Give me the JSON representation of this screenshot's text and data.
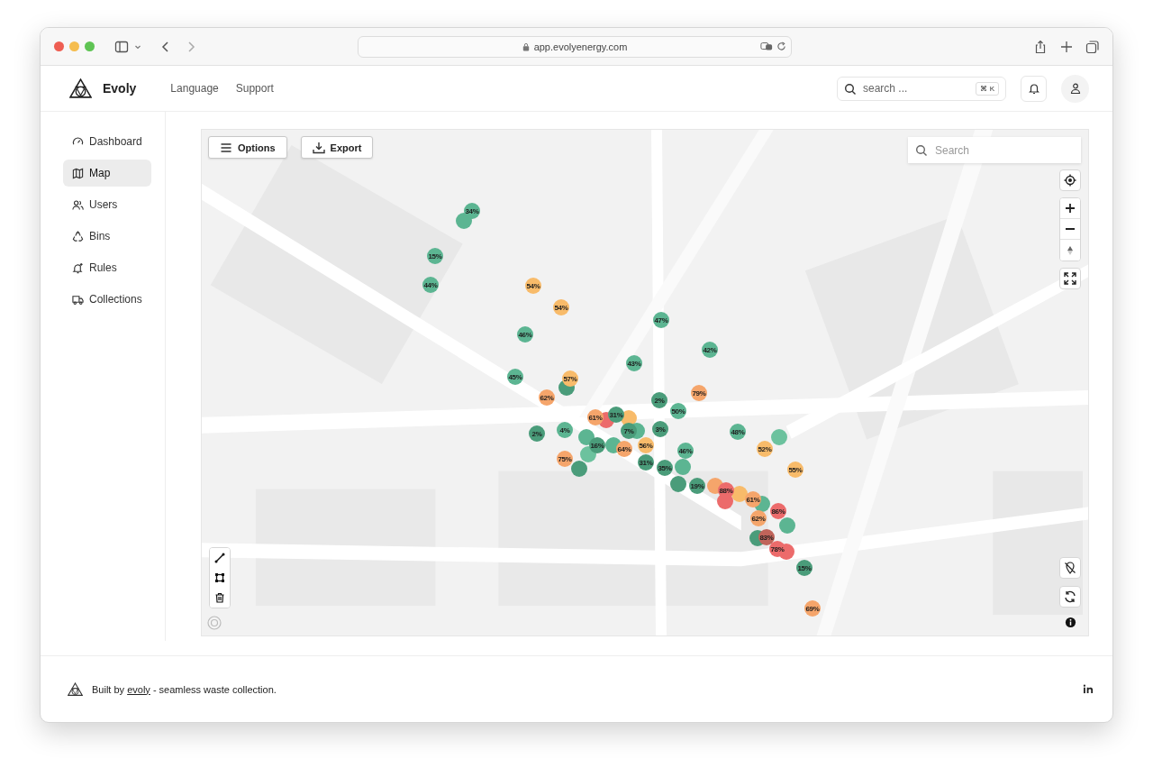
{
  "browser": {
    "url": "app.evolyenergy.com"
  },
  "header": {
    "brand": "Evoly",
    "nav": [
      "Language",
      "Support"
    ],
    "search": {
      "placeholder": "search ...",
      "shortcut": "⌘ K"
    }
  },
  "sidebar": {
    "items": [
      {
        "label": "Dashboard",
        "kind": "gauge",
        "selected": false
      },
      {
        "label": "Map",
        "kind": "map",
        "selected": true
      },
      {
        "label": "Users",
        "kind": "users",
        "selected": false
      },
      {
        "label": "Bins",
        "kind": "recycle",
        "selected": false
      },
      {
        "label": "Rules",
        "kind": "bell",
        "selected": false
      },
      {
        "label": "Collections",
        "kind": "truck",
        "selected": false
      }
    ]
  },
  "map": {
    "buttons": [
      {
        "label": "Options",
        "kind": "menu"
      },
      {
        "label": "Export",
        "kind": "download"
      }
    ],
    "search": {
      "placeholder": "Search"
    },
    "markers": [
      {
        "label": "34%",
        "color": "#5cb592"
      },
      {
        "color": "#5cb592"
      },
      {
        "label": "15%",
        "color": "#5cb592"
      },
      {
        "label": "44%",
        "color": "#5cb592"
      },
      {
        "label": "54%",
        "color": "#f8bb6a"
      },
      {
        "label": "54%",
        "color": "#f8bb6a"
      },
      {
        "label": "47%",
        "color": "#5cb592"
      },
      {
        "label": "46%",
        "color": "#5cb592"
      },
      {
        "label": "42%",
        "color": "#5cb592"
      },
      {
        "label": "43%",
        "color": "#5cb592"
      },
      {
        "label": "45%",
        "color": "#5cb592"
      },
      {
        "label": "57%",
        "color": "#f8bb6a"
      },
      {
        "color": "#4a9c7a"
      },
      {
        "label": "79%",
        "color": "#f5a56b"
      },
      {
        "label": "62%",
        "color": "#f5a56b"
      },
      {
        "label": "2%",
        "color": "#4a9c7a"
      },
      {
        "label": "50%",
        "color": "#5cb592"
      },
      {
        "label": "31%",
        "color": "#4a9c7a"
      },
      {
        "label": "61%",
        "color": "#f5a56b"
      },
      {
        "color": "#f8bb6a"
      },
      {
        "color": "#ec6b6b"
      },
      {
        "label": "7%",
        "color": "#4a9c7a"
      },
      {
        "label": "2%",
        "color": "#4a9c7a"
      },
      {
        "label": "4%",
        "color": "#5cb592"
      },
      {
        "color": "#5cb592"
      },
      {
        "label": "3%",
        "color": "#4a9c7a"
      },
      {
        "label": "48%",
        "color": "#5cb592"
      },
      {
        "color": "#5cb592"
      },
      {
        "color": "#6cc29e"
      },
      {
        "label": "16%",
        "color": "#4a9c7a"
      },
      {
        "color": "#5cb592"
      },
      {
        "label": "56%",
        "color": "#f8bb6a"
      },
      {
        "label": "64%",
        "color": "#f5a56b"
      },
      {
        "label": "52%",
        "color": "#f8bb6a"
      },
      {
        "label": "46%",
        "color": "#5cb592"
      },
      {
        "color": "#6cc29e"
      },
      {
        "label": "75%",
        "color": "#f5a56b"
      },
      {
        "color": "#4a9c7a"
      },
      {
        "label": "31%",
        "color": "#4a9c7a"
      },
      {
        "label": "35%",
        "color": "#4a9c7a"
      },
      {
        "color": "#5cb592"
      },
      {
        "label": "55%",
        "color": "#f8bb6a"
      },
      {
        "color": "#4a9c7a"
      },
      {
        "label": "19%",
        "color": "#4a9c7a"
      },
      {
        "color": "#f5a56b"
      },
      {
        "label": "88%",
        "color": "#ec6b6b"
      },
      {
        "color": "#f8bb6a"
      },
      {
        "label": "61%",
        "color": "#f5a56b"
      },
      {
        "color": "#ec6b6b"
      },
      {
        "color": "#5cb592"
      },
      {
        "label": "86%",
        "color": "#ec6b6b"
      },
      {
        "label": "62%",
        "color": "#f5a56b"
      },
      {
        "color": "#5cb592"
      },
      {
        "label": "83%",
        "color": "#c0645a"
      },
      {
        "color": "#4a9c7a"
      },
      {
        "label": "78%",
        "color": "#ec6b6b"
      },
      {
        "color": "#ec6b6b"
      },
      {
        "label": "15%",
        "color": "#4a9c7a"
      },
      {
        "label": "69%",
        "color": "#f5a56b"
      }
    ]
  },
  "footer": {
    "prefix": "Built by ",
    "link": "evoly",
    "suffix": " - seamless waste collection."
  }
}
